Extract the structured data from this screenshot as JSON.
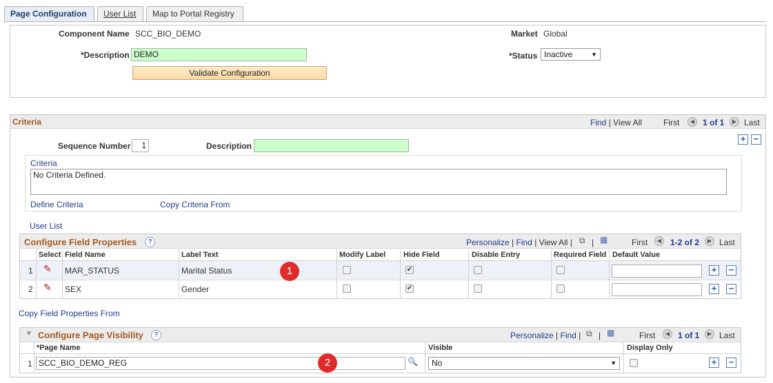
{
  "tabs": [
    {
      "label": "Page Configuration",
      "active": true
    },
    {
      "label": "User List",
      "active": false
    },
    {
      "label": "Map to Portal Registry",
      "active": false
    }
  ],
  "header": {
    "component_label": "Component Name",
    "component_value": "SCC_BIO_DEMO",
    "description_label": "*Description",
    "description_value": "DEMO",
    "validate_button": "Validate Configuration",
    "market_label": "Market",
    "market_value": "Global",
    "status_label": "*Status",
    "status_value": "Inactive"
  },
  "criteria": {
    "title": "Criteria",
    "find": "Find",
    "view_all": "View All",
    "first": "First",
    "count": "1 of 1",
    "last": "Last",
    "sequence_label": "Sequence Number",
    "sequence_value": "1",
    "description_label": "Description",
    "description_value": "",
    "criteria_label": "Criteria",
    "criteria_text": "No Criteria Defined.",
    "define_link": "Define Criteria",
    "copy_link": "Copy Criteria From",
    "user_list_link": "User List"
  },
  "field_props": {
    "title": "Configure Field Properties",
    "personalize": "Personalize",
    "find": "Find",
    "view_all": "View All",
    "first": "First",
    "count": "1-2 of 2",
    "last": "Last",
    "columns": {
      "select": "Select",
      "field_name": "Field Name",
      "label_text": "Label Text",
      "modify_label": "Modify Label",
      "hide_field": "Hide Field",
      "disable_entry": "Disable Entry",
      "required_field": "Required Field",
      "default_value": "Default Value"
    },
    "rows": [
      {
        "num": "1",
        "field": "MAR_STATUS",
        "label": "Marital Status",
        "modify": false,
        "hide": true,
        "disable": false,
        "required": false,
        "default": ""
      },
      {
        "num": "2",
        "field": "SEX",
        "label": "Gender",
        "modify": false,
        "hide": true,
        "disable": false,
        "required": false,
        "default": ""
      }
    ],
    "copy_link": "Copy Field Properties From",
    "marker": "1"
  },
  "page_visibility": {
    "title": "Configure Page Visibility",
    "personalize": "Personalize",
    "find": "Find",
    "first": "First",
    "count": "1 of 1",
    "last": "Last",
    "columns": {
      "page_name": "*Page Name",
      "visible": "Visible",
      "display_only": "Display Only"
    },
    "rows": [
      {
        "num": "1",
        "page": "SCC_BIO_DEMO_REG",
        "visible": "No",
        "display_only": false
      }
    ],
    "marker": "2"
  },
  "glyphs": {
    "plus": "+",
    "minus": "−",
    "prev": "◀",
    "next": "▶",
    "pipe": "|",
    "help": "?",
    "check": "✔",
    "caret": "▼",
    "collapse": "▼",
    "pencil": "✎",
    "search": "🔍",
    "grid": "▦",
    "zoom": "⧉"
  },
  "colors": {
    "section_title": "#a35b24",
    "link": "#1f3a8a",
    "required_bg": "#ccffcc",
    "marker": "#e02b2b"
  }
}
